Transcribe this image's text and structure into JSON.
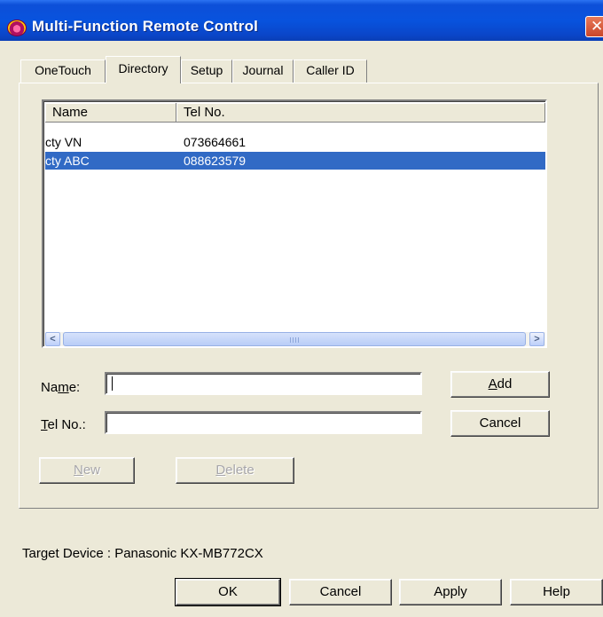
{
  "window": {
    "title": "Multi-Function Remote Control",
    "close_glyph": "✕"
  },
  "tabs": [
    {
      "label": "OneTouch",
      "active": false
    },
    {
      "label": "Directory",
      "active": true
    },
    {
      "label": "Setup",
      "active": false
    },
    {
      "label": "Journal",
      "active": false
    },
    {
      "label": "Caller ID",
      "active": false
    }
  ],
  "directory": {
    "columns": [
      "Name",
      "Tel No."
    ],
    "rows": [
      {
        "name": "cty VN",
        "tel": "073664661",
        "selected": false
      },
      {
        "name": "cty ABC",
        "tel": "088623579",
        "selected": true
      }
    ],
    "scrollbar": {
      "left_glyph": "<",
      "right_glyph": ">"
    }
  },
  "form": {
    "name_label_pre": "Na",
    "name_label_u": "m",
    "name_label_post": "e:",
    "name_value": "",
    "tel_label_u": "T",
    "tel_label_post": "el No.:",
    "tel_value": "",
    "add_u": "A",
    "add_post": "dd",
    "cancel_label": "Cancel",
    "new_u": "N",
    "new_post": "ew",
    "delete_u": "D",
    "delete_post": "elete"
  },
  "status": {
    "target_device": "Target Device : Panasonic KX-MB772CX"
  },
  "footer": {
    "ok": "OK",
    "cancel": "Cancel",
    "apply": "Apply",
    "help": "Help"
  },
  "colors": {
    "titlebar": "#0853de",
    "selection": "#316ac5",
    "face": "#ece9d8"
  },
  "icons": {
    "app": "multi-function-app-icon",
    "close": "close-icon"
  }
}
